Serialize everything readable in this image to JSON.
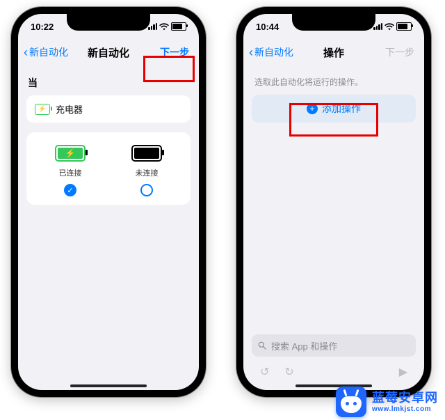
{
  "left": {
    "status": {
      "time": "10:22"
    },
    "nav": {
      "back": "新自动化",
      "title": "新自动化",
      "next": "下一步"
    },
    "section_label": "当",
    "trigger_row": "充电器",
    "choices": {
      "connected": "已连接",
      "disconnected": "未连接"
    }
  },
  "right": {
    "status": {
      "time": "10:44"
    },
    "nav": {
      "back": "新自动化",
      "title": "操作",
      "next": "下一步"
    },
    "helper": "选取此自动化将运行的操作。",
    "add_action": "添加操作",
    "search_placeholder": "搜索 App 和操作"
  },
  "watermark": {
    "name": "蓝莓安卓网",
    "url": "www.lmkjst.com"
  }
}
